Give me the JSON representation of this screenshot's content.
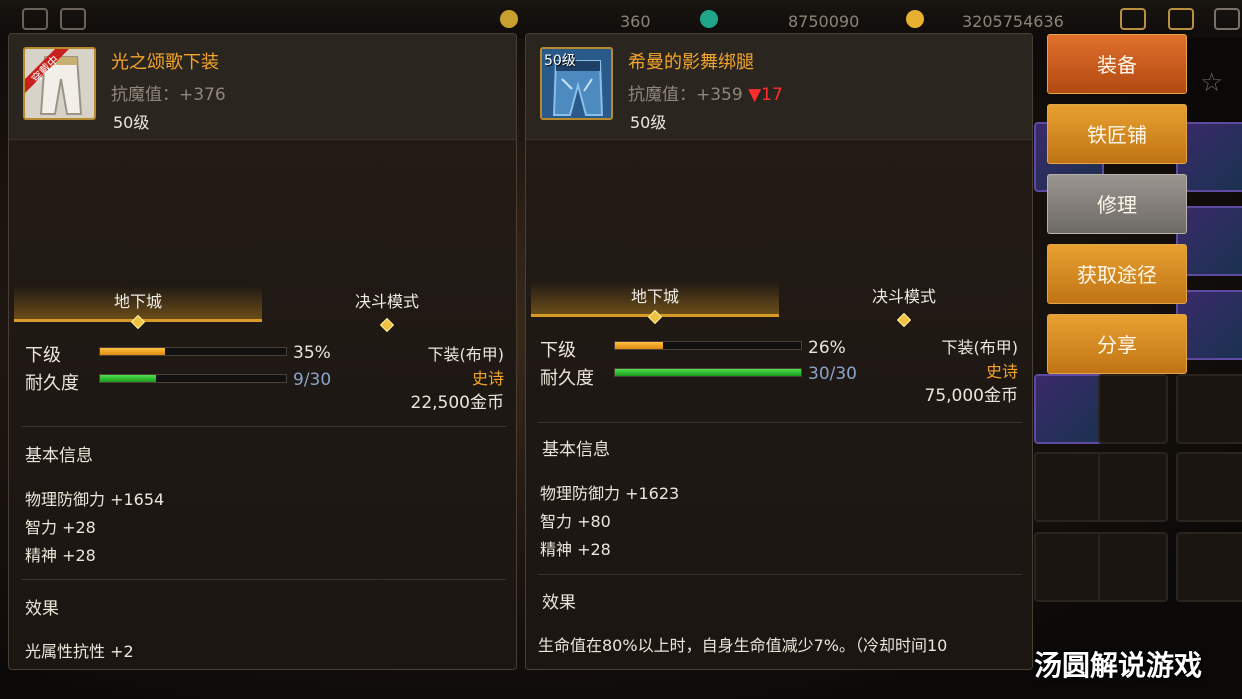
{
  "topbar": {
    "res1": "360",
    "res2": "8750090",
    "res3": "3205754636"
  },
  "left_item": {
    "badge_text": "穿戴中",
    "name": "光之颂歌下装",
    "stat_label": "抗魔值",
    "stat_value": "+376",
    "level": "50级",
    "tab_dungeon": "地下城",
    "tab_duel": "决斗模式",
    "grade_label": "下级",
    "grade_pct": "35%",
    "grade_fill": 0.35,
    "durability_label": "耐久度",
    "durability": "9/30",
    "durability_fill": 0.3,
    "slot": "下装(布甲)",
    "rarity": "史诗",
    "price": "22,500金币",
    "basic_info_title": "基本信息",
    "attributes": [
      "物理防御力 +1654",
      "智力 +28",
      "精神 +28"
    ],
    "effect_title": "效果",
    "effect": "光属性抗性 +2"
  },
  "right_item": {
    "level_badge": "50级",
    "name": "希曼的影舞绑腿",
    "stat_label": "抗魔值",
    "stat_value": "+359",
    "stat_diff": "▼17",
    "level": "50级",
    "tab_dungeon": "地下城",
    "tab_duel": "决斗模式",
    "grade_label": "下级",
    "grade_pct": "26%",
    "grade_fill": 0.26,
    "durability_label": "耐久度",
    "durability": "30/30",
    "durability_fill": 1.0,
    "slot": "下装(布甲)",
    "rarity": "史诗",
    "price": "75,000金币",
    "basic_info_title": "基本信息",
    "attributes": [
      "物理防御力 +1623",
      "智力 +80",
      "精神 +28"
    ],
    "effect_title": "效果",
    "effect": "生命值在80%以上时，自身生命值减少7%。（冷却时间10"
  },
  "actions": {
    "equip": "装备",
    "blacksmith": "铁匠铺",
    "repair": "修理",
    "obtain": "获取途径",
    "share": "分享"
  },
  "watermark": "汤圆解说游戏",
  "colors": {
    "accent": "#f3a52b",
    "down": "#ff2d2d",
    "grade_bar": "#f0a020",
    "durability_bar": "#2fc42f"
  }
}
